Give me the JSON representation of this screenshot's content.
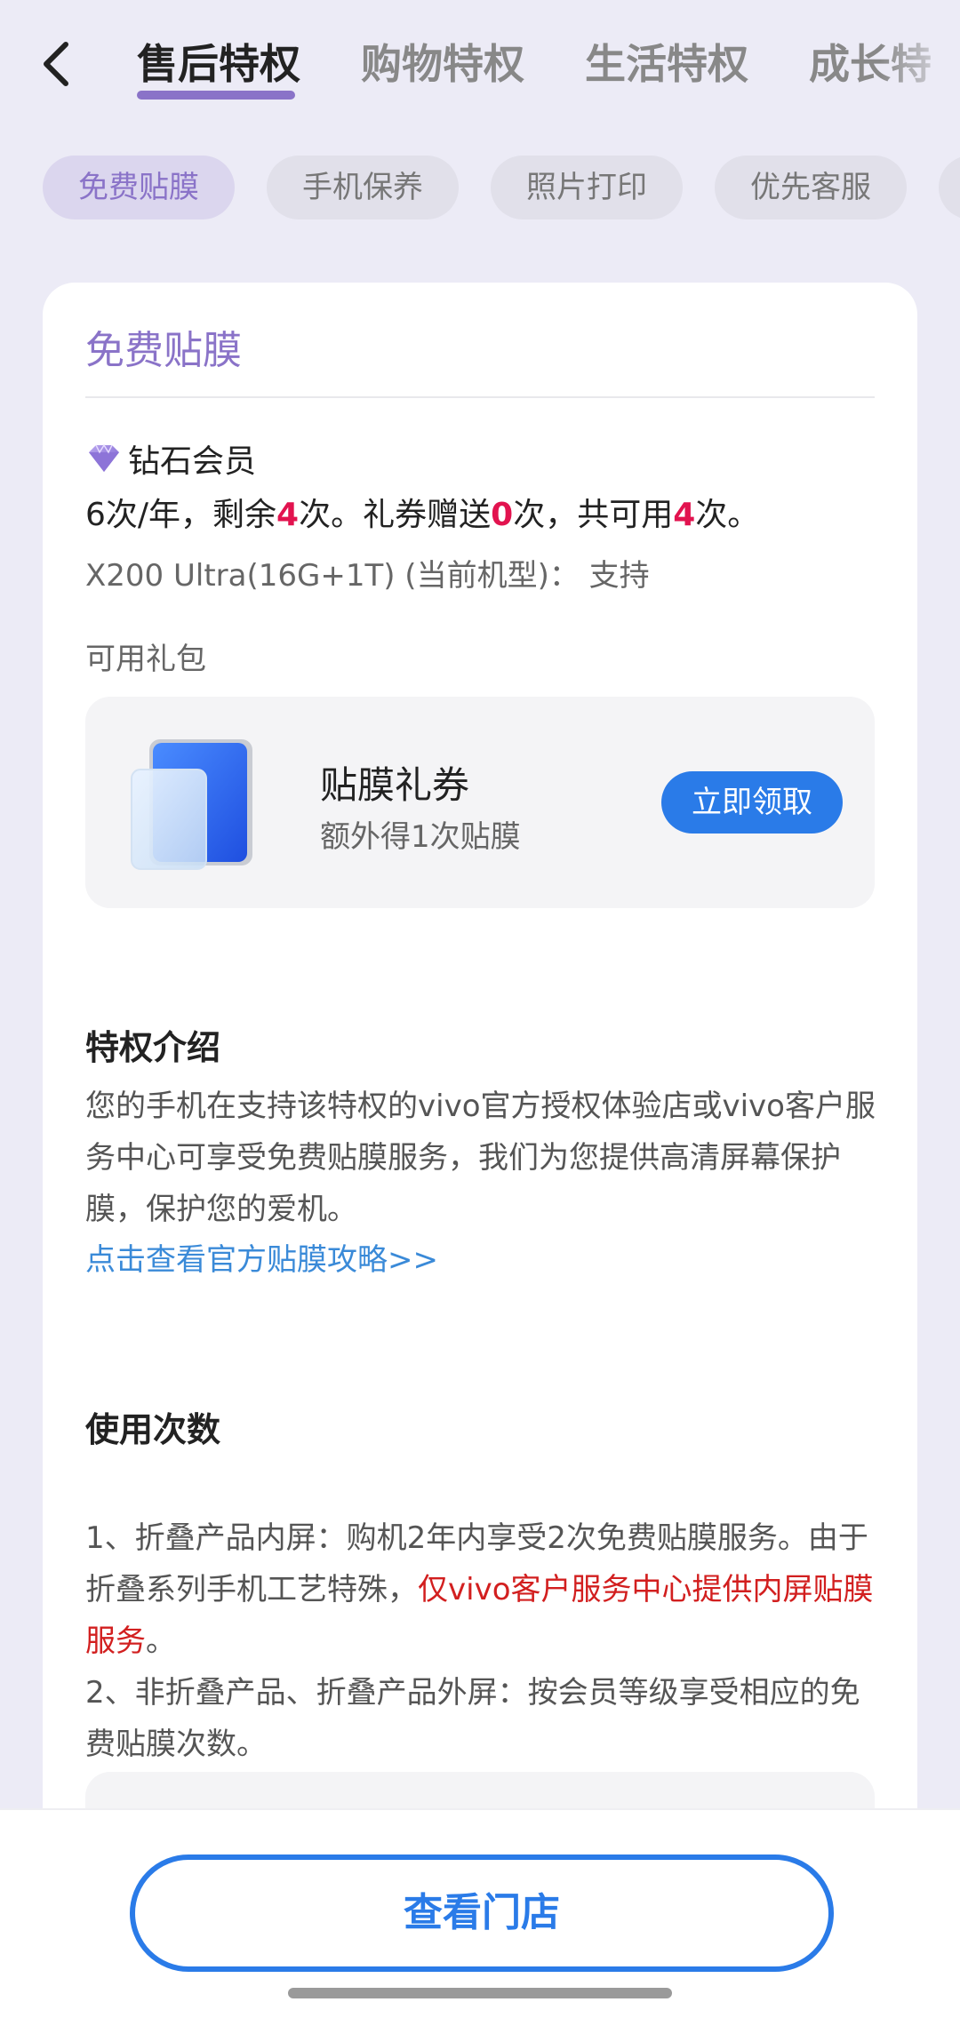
{
  "tabs": [
    {
      "label": "售后特权"
    },
    {
      "label": "购物特权"
    },
    {
      "label": "生活特权"
    },
    {
      "label": "成长特"
    }
  ],
  "chips": [
    {
      "label": "免费贴膜"
    },
    {
      "label": "手机保养"
    },
    {
      "label": "照片打印"
    },
    {
      "label": "优先客服"
    }
  ],
  "card": {
    "title": "免费贴膜",
    "member_level": "钻石会员",
    "usage": {
      "p1": "6次/年，剩余",
      "remaining": "4",
      "p2": "次。礼券赠送",
      "gifted": "0",
      "p3": "次，共可用",
      "total": "4",
      "p4": "次。"
    },
    "model_line": "X200 Ultra(16G+1T) (当前机型)： 支持",
    "gift_label": "可用礼包",
    "gift": {
      "title": "贴膜礼券",
      "subtitle": "额外得1次贴膜",
      "button": "立即领取"
    },
    "intro": {
      "title": "特权介绍",
      "text": "您的手机在支持该特权的vivo官方授权体验店或vivo客户服务中心可享受免费贴膜服务，我们为您提供高清屏幕保护膜，保护您的爱机。",
      "link": "点击查看官方贴膜攻略>>"
    },
    "usage_rules": {
      "title": "使用次数",
      "rule1_a": "1、折叠产品内屏：购机2年内享受2次免费贴膜服务。由于折叠系列手机工艺特殊，",
      "rule1_red": "仅vivo客户服务中心提供内屏贴膜服务",
      "rule1_b": "。",
      "rule2": "2、非折叠产品、折叠产品外屏：按会员等级享受相应的免费贴膜次数。"
    }
  },
  "bottom": {
    "button": "查看门店"
  },
  "colors": {
    "accent": "#8a73c8",
    "primary": "#2a7be8",
    "highlight": "#e2134f",
    "warning_text": "#d21f1f",
    "link": "#3a8ad8",
    "page_bg": "#ecebf6"
  }
}
